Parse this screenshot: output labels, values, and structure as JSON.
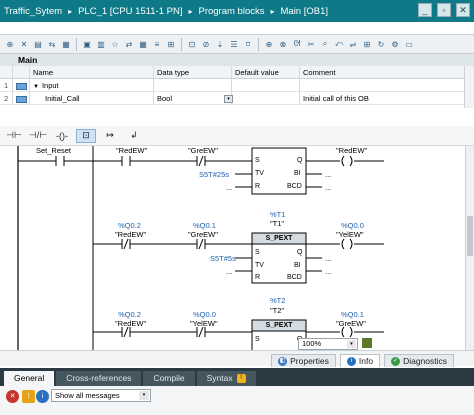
{
  "breadcrumb": {
    "items": [
      "Traffic_Sytem",
      "PLC_1 [CPU 1511-1 PN]",
      "Program blocks",
      "Main [OB1]"
    ],
    "separator": "▸"
  },
  "window_controls": [
    "_",
    "▫",
    "✕"
  ],
  "interface": {
    "title": "Main",
    "columns": [
      "Name",
      "Data type",
      "Default value",
      "Comment"
    ],
    "rows": [
      {
        "num": "1",
        "name": "Input",
        "type": "",
        "default": "",
        "comment": ""
      },
      {
        "num": "2",
        "name": "Initial_Call",
        "type": "Bool",
        "default": "",
        "comment": "Initial call of this OB"
      }
    ]
  },
  "rungs": [
    {
      "contact1": "Set_Reset",
      "contact2": "\"RedEW\"",
      "contact3": "\"GreEW\"",
      "coil": "\"RedEW\"",
      "timer_addr": "",
      "timer_name": "",
      "timer_type": "S_PEXT",
      "tv_value": "S5T#25s"
    },
    {
      "contact1_addr": "%Q0.2",
      "contact1": "\"RedEW\"",
      "contact2_addr": "%Q0.1",
      "contact2": "\"GreEW\"",
      "coil_addr": "%Q0.0",
      "coil": "\"YelEW\"",
      "timer_addr": "%T1",
      "timer_name": "\"T1\"",
      "timer_type": "S_PEXT",
      "tv_value": "S5T#5s"
    },
    {
      "contact1_addr": "%Q0.2",
      "contact1": "\"RedEW\"",
      "contact2_addr": "%Q0.0",
      "contact2": "\"YelEW\"",
      "coil_addr": "%Q0.1",
      "coil": "\"GreEW\"",
      "timer_addr": "%T2",
      "timer_name": "\"T2\"",
      "timer_type": "S_PEXT"
    }
  ],
  "timer_pins": {
    "s": "S",
    "tv": "TV",
    "r": "R",
    "q": "Q",
    "bi": "BI",
    "bcd": "BCD"
  },
  "zoom": "100%",
  "inspector_tabs": [
    "Properties",
    "Info",
    "Diagnostics"
  ],
  "section_tabs": [
    "General",
    "Cross-references",
    "Compile",
    "Syntax"
  ],
  "filter": {
    "selected": "Show all messages"
  },
  "colors": {
    "accent": "#0e7a88",
    "address": "#1f5fb0",
    "tv_value": "#1f5fb0"
  }
}
